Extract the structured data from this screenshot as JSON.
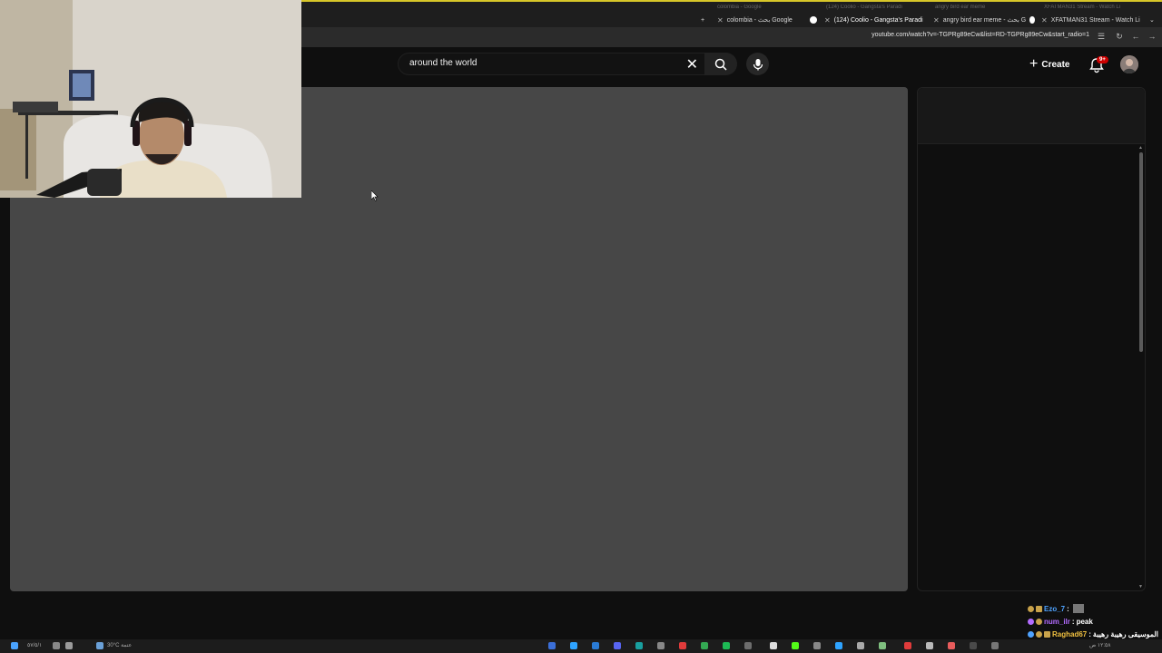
{
  "browser": {
    "tabs": [
      {
        "label": "colombia - بحث Google",
        "favicon_color": "#ffffff",
        "active": false
      },
      {
        "label": "(124) Coolio - Gangsta's Paradi",
        "favicon_color": "#ffffff",
        "active": true
      },
      {
        "label": "angry bird ear meme - بحث G",
        "favicon_color": "#ff3b30",
        "active": false
      },
      {
        "label": "XFATMAN31 Stream - Watch Li",
        "favicon_color": "#ffffff",
        "active": false
      }
    ],
    "ghost_tabs": [
      "colombia - Google",
      "(124) Coolio - Gangsta's Paradi",
      "angry bird ear meme",
      "XFATMAN31 Stream - Watch Li"
    ],
    "url": "youtube.com/watch?v=-TGPRg89eCw&list=RD-TGPRg89eCw&start_radio=1"
  },
  "youtube": {
    "search_value": "around the world",
    "create_label": "Create",
    "notification_badge": "9+"
  },
  "chat": [
    {
      "user": "Ezo_7",
      "sep": " :",
      "message": "",
      "user_color": "#4fa3ff",
      "align": "left"
    },
    {
      "user": "num_ilr",
      "sep": " :",
      "message": "peak",
      "user_color": "#b36cff",
      "align": "left"
    },
    {
      "user": "Raghad67",
      "sep": " :",
      "message": "الموسيقى رهيبة رهيبة",
      "user_color": "#f0c040",
      "align": "left"
    }
  ],
  "taskbar": {
    "weather": "30°C عتمة",
    "date": "٥٧/٥/١",
    "time": "١٢:٥٨ ص"
  },
  "colors": {
    "accent": "#d7c629",
    "player_bg": "#474747",
    "page_bg": "#0f0f0f"
  },
  "icons": [
    "close-icon",
    "search-icon",
    "mic-icon",
    "plus-icon",
    "bell-icon",
    "avatar",
    "reload-icon",
    "back-icon",
    "forward-icon"
  ]
}
